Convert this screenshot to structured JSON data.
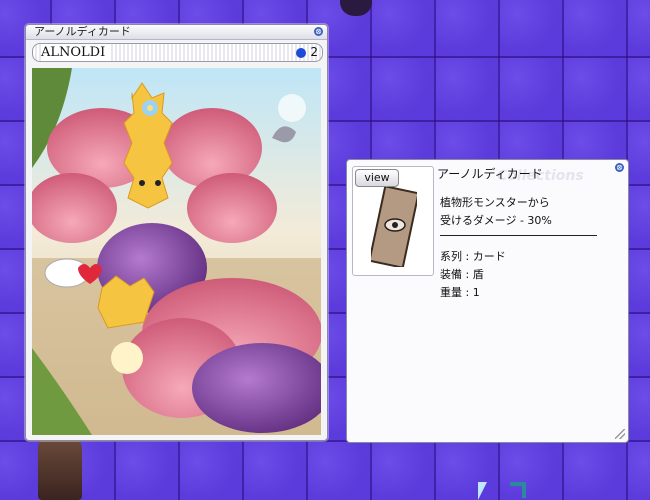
{
  "card_window": {
    "title": "アーノルディカード",
    "close_glyph": "⊗",
    "card_name": "ALNOLDI",
    "slot_count": "2"
  },
  "desc_window": {
    "close_glyph": "⊗",
    "view_label": "view",
    "watermark": "Collections",
    "title": "アーノルディカード",
    "effect_line1": "植物形モンスターから",
    "effect_line2": "受けるダメージ - 30%",
    "type_line": "系列 : カード",
    "equip_line": "装備 : 盾",
    "weight_line": "重量 : 1"
  },
  "colors": {
    "floor": "#5b3bdb",
    "slot_dot": "#1f49d8",
    "close_button": "#3a5fbf"
  },
  "icons": [
    "close-icon",
    "slot-orb-icon",
    "card-eye-icon",
    "mouse-cursor-icon"
  ]
}
